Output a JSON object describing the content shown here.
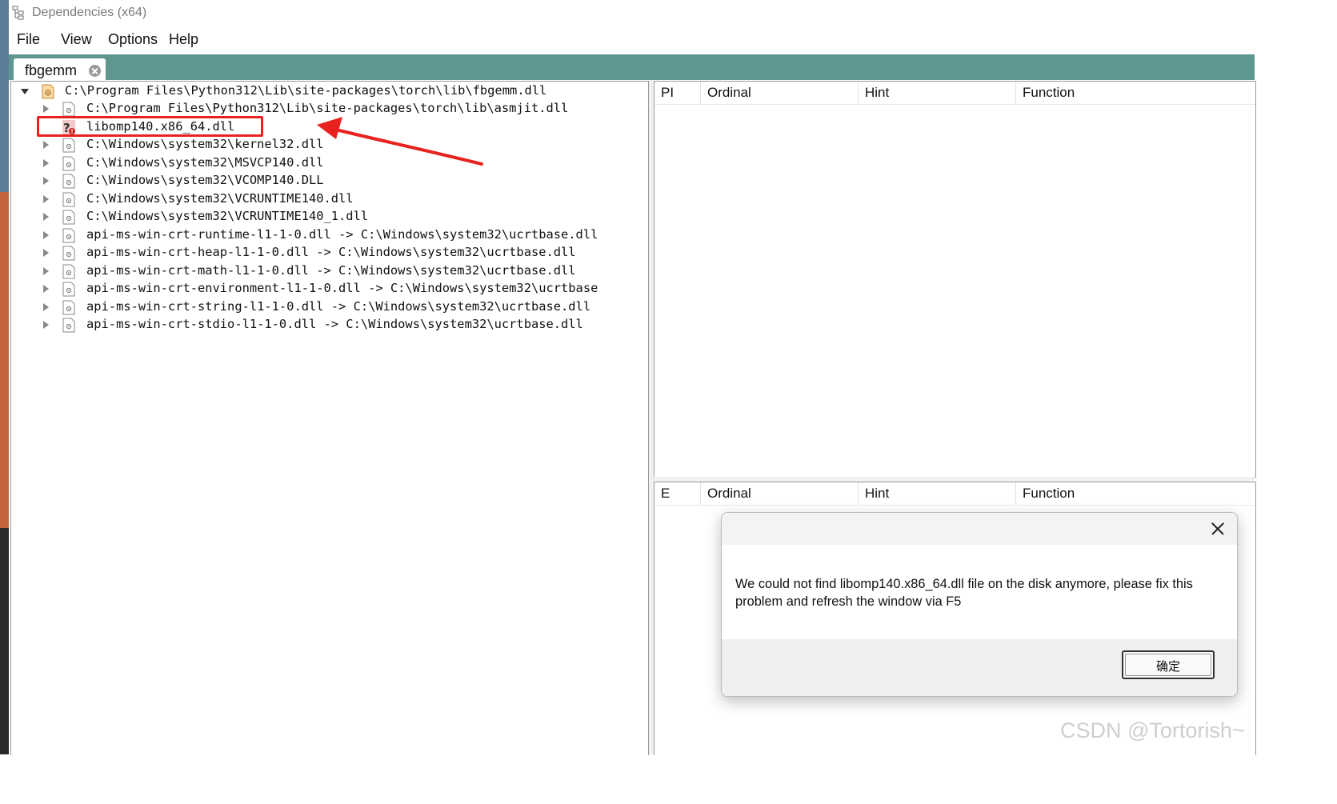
{
  "window": {
    "title": "Dependencies (x64)"
  },
  "menu": {
    "file": "File",
    "view": "View",
    "options": "Options",
    "help": "Help"
  },
  "tab": {
    "label": "fbgemm"
  },
  "tree": {
    "root": "C:\\Program Files\\Python312\\Lib\\site-packages\\torch\\lib\\fbgemm.dll",
    "children": [
      "C:\\Program Files\\Python312\\Lib\\site-packages\\torch\\lib\\asmjit.dll",
      "libomp140.x86_64.dll",
      "C:\\Windows\\system32\\kernel32.dll",
      "C:\\Windows\\system32\\MSVCP140.dll",
      "C:\\Windows\\system32\\VCOMP140.DLL",
      "C:\\Windows\\system32\\VCRUNTIME140.dll",
      "C:\\Windows\\system32\\VCRUNTIME140_1.dll",
      "api-ms-win-crt-runtime-l1-1-0.dll -> C:\\Windows\\system32\\ucrtbase.dll",
      "api-ms-win-crt-heap-l1-1-0.dll -> C:\\Windows\\system32\\ucrtbase.dll",
      "api-ms-win-crt-math-l1-1-0.dll -> C:\\Windows\\system32\\ucrtbase.dll",
      "api-ms-win-crt-environment-l1-1-0.dll -> C:\\Windows\\system32\\ucrtbase",
      "api-ms-win-crt-string-l1-1-0.dll -> C:\\Windows\\system32\\ucrtbase.dll",
      "api-ms-win-crt-stdio-l1-1-0.dll -> C:\\Windows\\system32\\ucrtbase.dll"
    ]
  },
  "imports_grid": {
    "columns": [
      "PI",
      "Ordinal",
      "Hint",
      "Function"
    ]
  },
  "exports_grid": {
    "columns": [
      "E",
      "Ordinal",
      "Hint",
      "Function"
    ]
  },
  "dialog": {
    "message": "We could not find libomp140.x86_64.dll file on the disk anymore, please fix this problem and refresh the window via F5",
    "ok_label": "确定"
  },
  "watermark": "CSDN @Tortorish~",
  "colors": {
    "tab_strip": "#5f968f",
    "annotation_red": "#e8231f"
  },
  "icons": {
    "missing_module": "question-error-icon",
    "module": "dll-file-icon",
    "root_module": "dll-root-icon"
  }
}
